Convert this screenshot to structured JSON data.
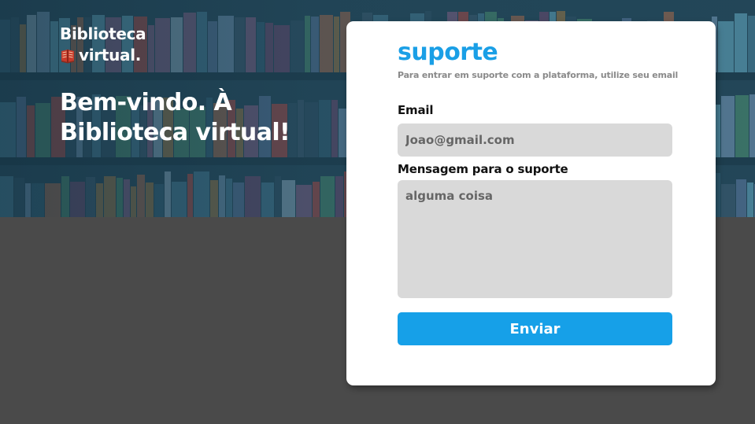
{
  "brand": {
    "line1": "Biblioteca",
    "line2": "virtual.",
    "icon": "book-icon"
  },
  "hero": {
    "welcome": "Bem-vindo. À Biblioteca virtual!"
  },
  "support_form": {
    "title": "suporte",
    "subtitle": "Para entrar em suporte com a plataforma, utilize seu email",
    "email_label": "Email",
    "email_value": "Joao@gmail.com",
    "message_label": "Mensagem para o suporte",
    "message_value": "alguma coisa",
    "submit_label": "Enviar"
  },
  "colors": {
    "accent": "#16a0e8",
    "title": "#1a9fe6",
    "background": "#4a4a4a",
    "input_bg": "#d9d9d9"
  }
}
